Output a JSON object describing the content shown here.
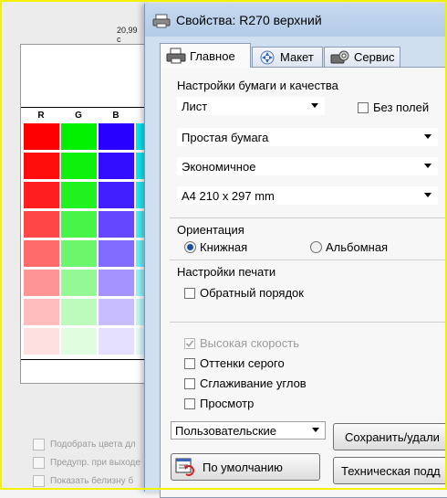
{
  "background_app": {
    "ruler_value": "20,99 c",
    "columns": [
      "R",
      "G",
      "B"
    ],
    "options": [
      "Подобрать цвета дл",
      "Предупр. при выходе",
      "Показать белизну б"
    ]
  },
  "dialog": {
    "title": "Свойства: R270 верхний",
    "tabs": [
      {
        "label": "Главное",
        "active": true
      },
      {
        "label": "Макет",
        "active": false
      },
      {
        "label": "Сервис",
        "active": false
      }
    ],
    "paper_group_title": "Настройки бумаги и качества",
    "paper_source": "Лист",
    "borderless_label": "Без полей",
    "media_type": "Простая бумага",
    "quality": "Экономичное",
    "paper_size": "A4 210 x 297 mm",
    "orientation_title": "Ориентация",
    "orientation_options": [
      {
        "label": "Книжная",
        "selected": true
      },
      {
        "label": "Альбомная",
        "selected": false
      }
    ],
    "print_settings_title": "Настройки печати",
    "reverse_order_label": "Обратный порядок",
    "high_speed_label": "Высокая скорость",
    "grayscale_label": "Оттенки серого",
    "edge_smoothing_label": "Сглаживание углов",
    "preview_label": "Просмотр",
    "custom_settings": "Пользовательские",
    "save_delete_label": "Сохранить/удали",
    "defaults_label": "По умолчанию",
    "tech_support_label": "Техническая подд"
  },
  "colors": {
    "highlight_frame": "#f2f200",
    "title_bar": "#b9d0ec",
    "radio_selected": "#1a4fa0"
  }
}
